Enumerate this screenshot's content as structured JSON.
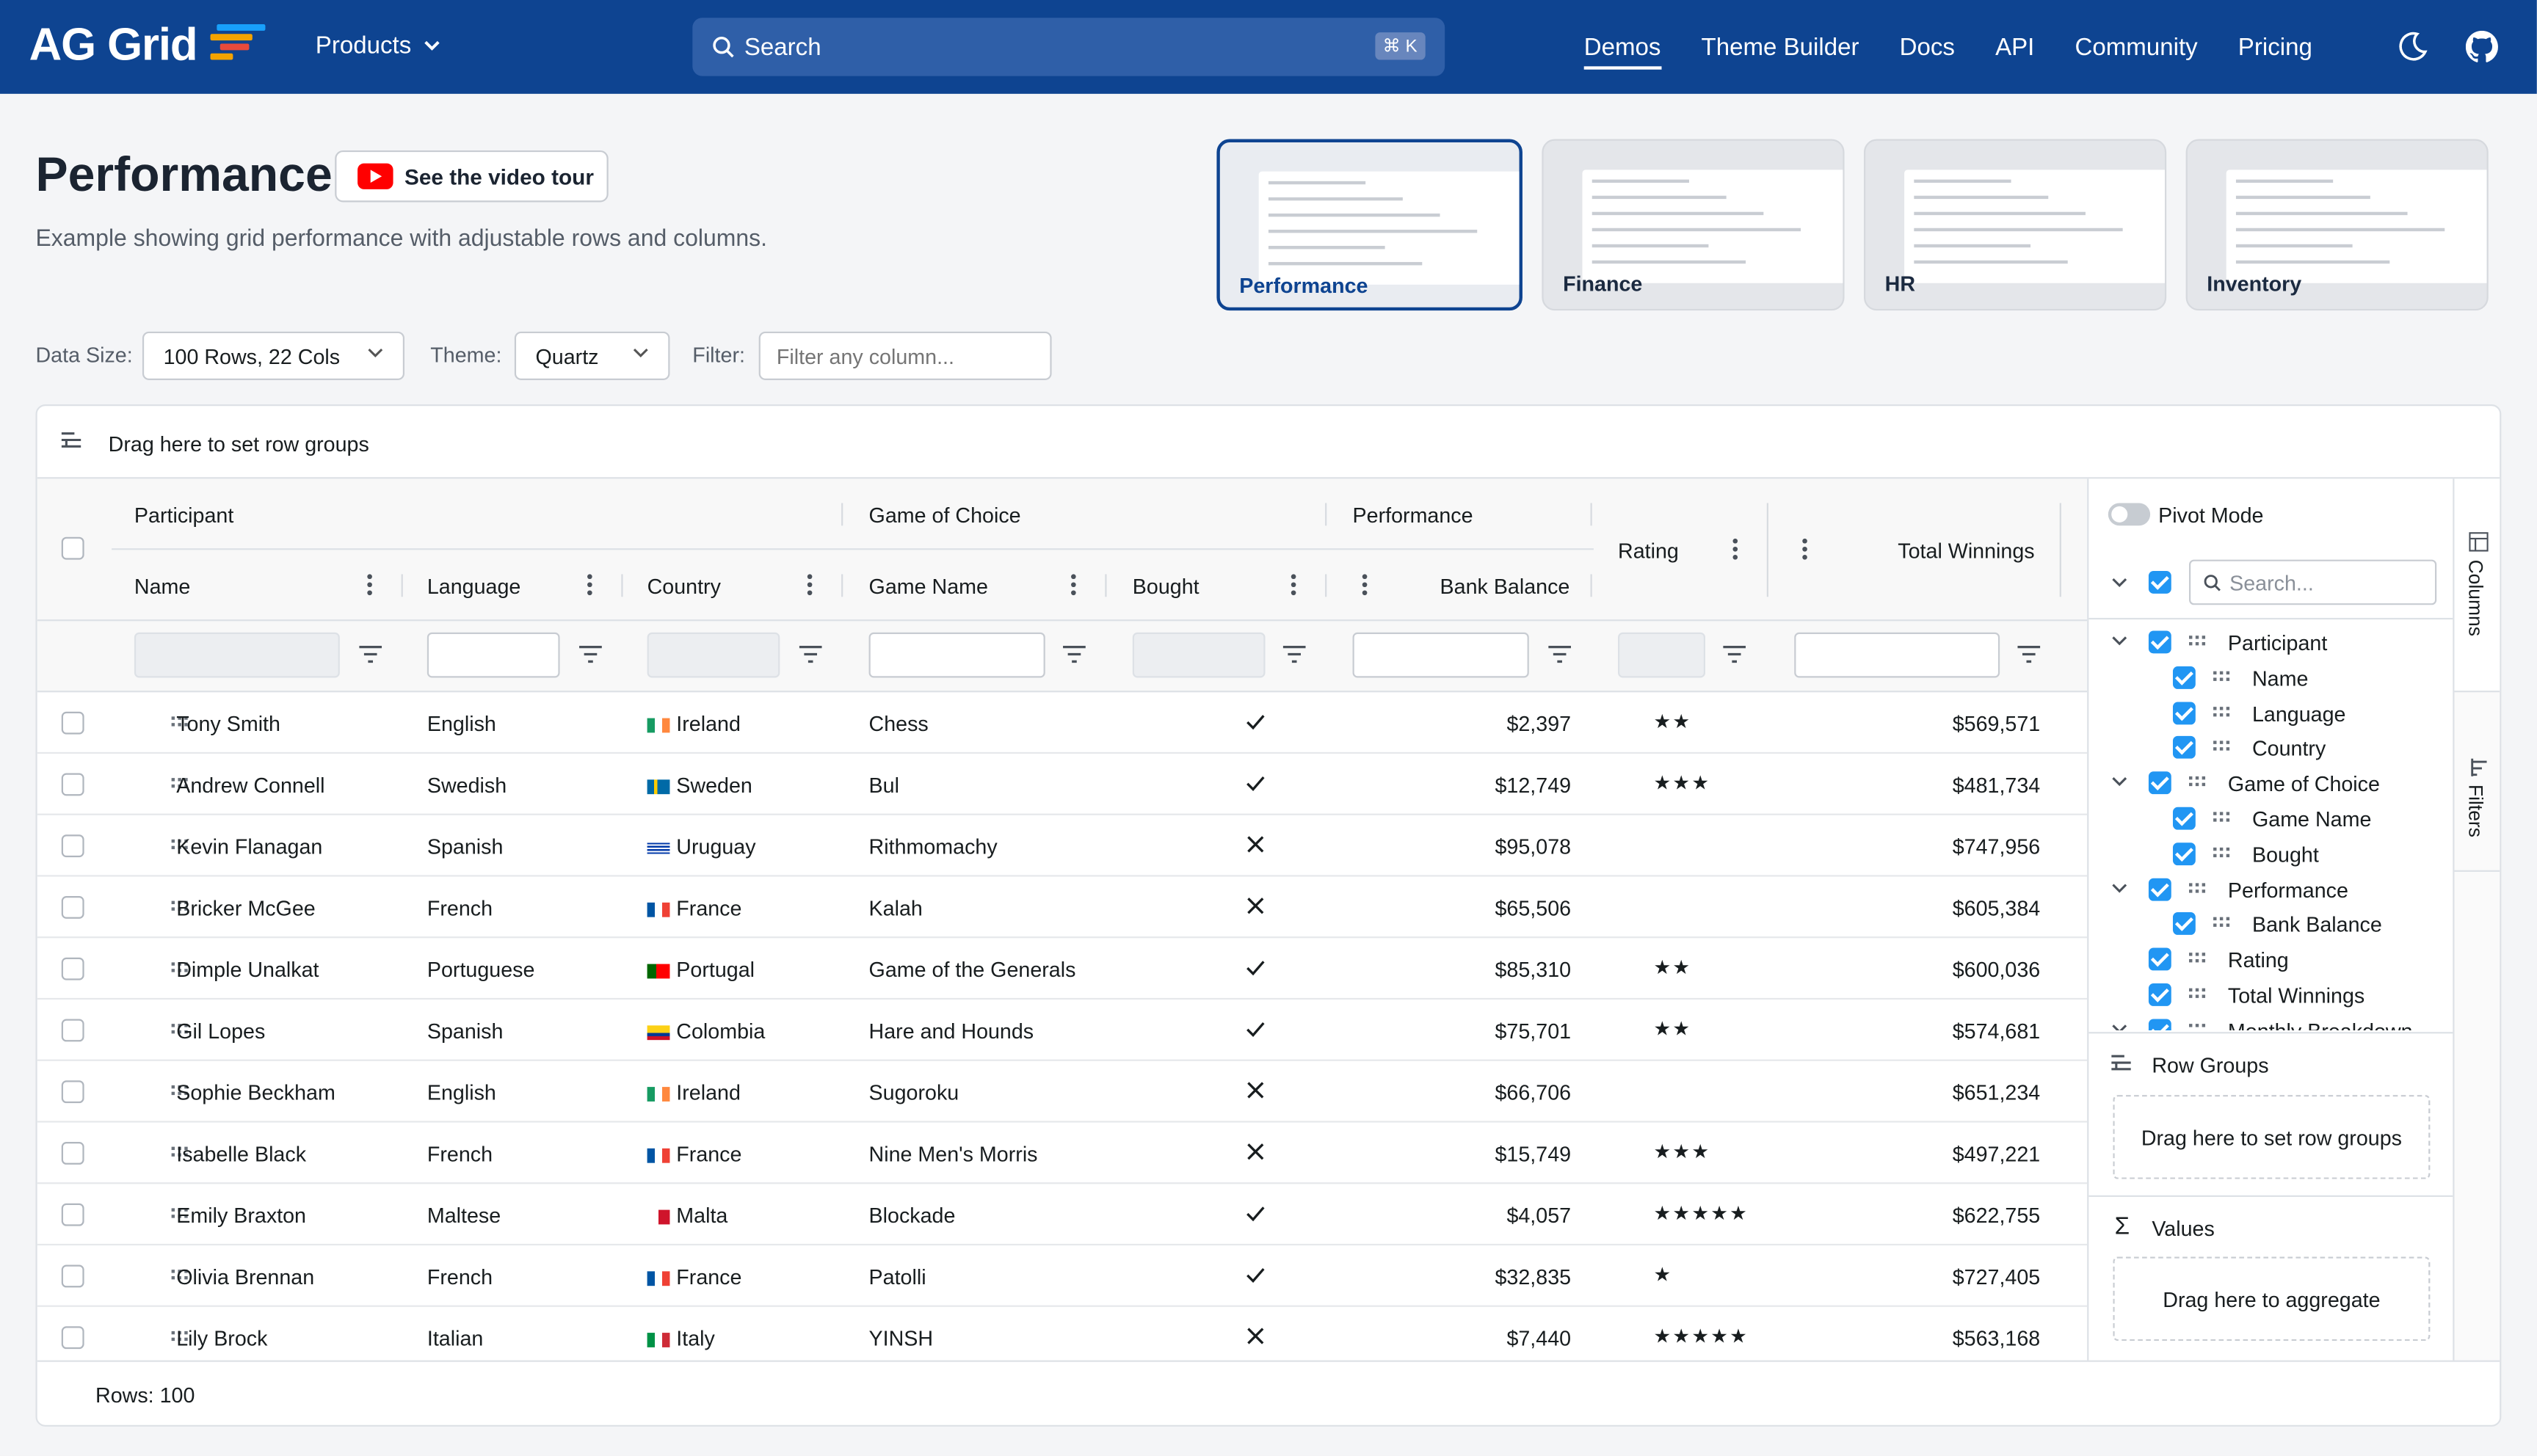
{
  "nav": {
    "brand": "AG Grid",
    "products": "Products",
    "search_placeholder": "Search",
    "search_shortcut": "⌘ K",
    "links": [
      "Demos",
      "Theme Builder",
      "Docs",
      "API",
      "Community",
      "Pricing"
    ],
    "active_link": "Demos"
  },
  "page": {
    "title": "Performance",
    "video_button": "See the video tour",
    "subtitle": "Example showing grid performance with adjustable rows and columns."
  },
  "demos": [
    {
      "label": "Performance",
      "active": true
    },
    {
      "label": "Finance",
      "active": false
    },
    {
      "label": "HR",
      "active": false
    },
    {
      "label": "Inventory",
      "active": false
    }
  ],
  "toolbar": {
    "data_size_label": "Data Size:",
    "data_size_value": "100 Rows, 22 Cols",
    "theme_label": "Theme:",
    "theme_value": "Quartz",
    "filter_label": "Filter:",
    "filter_placeholder": "Filter any column..."
  },
  "grid": {
    "row_group_hint": "Drag here to set row groups",
    "groups": {
      "participant": "Participant",
      "game": "Game of Choice",
      "performance": "Performance"
    },
    "columns": {
      "name": "Name",
      "language": "Language",
      "country": "Country",
      "game_name": "Game Name",
      "bought": "Bought",
      "bank_balance": "Bank Balance",
      "rating": "Rating",
      "total_winnings": "Total Winnings"
    },
    "rows": [
      {
        "name": "Tony Smith",
        "language": "English",
        "country": "Ireland",
        "flag": "ie",
        "game": "Chess",
        "bought": true,
        "balance": "$2,397",
        "rating": 2,
        "winnings": "$569,571"
      },
      {
        "name": "Andrew Connell",
        "language": "Swedish",
        "country": "Sweden",
        "flag": "se",
        "game": "Bul",
        "bought": true,
        "balance": "$12,749",
        "rating": 3,
        "winnings": "$481,734"
      },
      {
        "name": "Kevin Flanagan",
        "language": "Spanish",
        "country": "Uruguay",
        "flag": "uy",
        "game": "Rithmomachy",
        "bought": false,
        "balance": "$95,078",
        "rating": 0,
        "winnings": "$747,956"
      },
      {
        "name": "Bricker McGee",
        "language": "French",
        "country": "France",
        "flag": "fr",
        "game": "Kalah",
        "bought": false,
        "balance": "$65,506",
        "rating": 0,
        "winnings": "$605,384"
      },
      {
        "name": "Dimple Unalkat",
        "language": "Portuguese",
        "country": "Portugal",
        "flag": "pt",
        "game": "Game of the Generals",
        "bought": true,
        "balance": "$85,310",
        "rating": 2,
        "winnings": "$600,036"
      },
      {
        "name": "Gil Lopes",
        "language": "Spanish",
        "country": "Colombia",
        "flag": "co",
        "game": "Hare and Hounds",
        "bought": true,
        "balance": "$75,701",
        "rating": 2,
        "winnings": "$574,681"
      },
      {
        "name": "Sophie Beckham",
        "language": "English",
        "country": "Ireland",
        "flag": "ie",
        "game": "Sugoroku",
        "bought": false,
        "balance": "$66,706",
        "rating": 0,
        "winnings": "$651,234"
      },
      {
        "name": "Isabelle Black",
        "language": "French",
        "country": "France",
        "flag": "fr",
        "game": "Nine Men's Morris",
        "bought": false,
        "balance": "$15,749",
        "rating": 3,
        "winnings": "$497,221"
      },
      {
        "name": "Emily Braxton",
        "language": "Maltese",
        "country": "Malta",
        "flag": "mt",
        "game": "Blockade",
        "bought": true,
        "balance": "$4,057",
        "rating": 5,
        "winnings": "$622,755"
      },
      {
        "name": "Olivia Brennan",
        "language": "French",
        "country": "France",
        "flag": "fr",
        "game": "Patolli",
        "bought": true,
        "balance": "$32,835",
        "rating": 1,
        "winnings": "$727,405"
      },
      {
        "name": "Lily Brock",
        "language": "Italian",
        "country": "Italy",
        "flag": "it",
        "game": "YINSH",
        "bought": false,
        "balance": "$7,440",
        "rating": 5,
        "winnings": "$563,168"
      }
    ],
    "footer": "Rows: 100"
  },
  "side_panel": {
    "pivot_mode": "Pivot Mode",
    "search_placeholder": "Search...",
    "tree": [
      "Participant",
      "Name",
      "Language",
      "Country",
      "Game of Choice",
      "Game Name",
      "Bought",
      "Performance",
      "Bank Balance",
      "Rating",
      "Total Winnings",
      "Monthly Breakdown"
    ],
    "row_groups_title": "Row Groups",
    "row_groups_hint": "Drag here to set row groups",
    "values_title": "Values",
    "values_hint": "Drag here to aggregate",
    "tab_columns": "Columns",
    "tab_filters": "Filters"
  },
  "colors": {
    "nav_bg": "#0e4491",
    "accent": "#2196f3"
  }
}
